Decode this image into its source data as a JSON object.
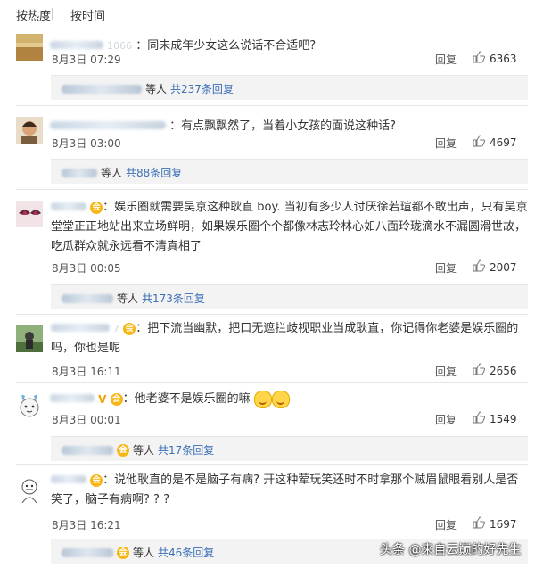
{
  "tabs": {
    "hot": "按热度",
    "time": "按时间"
  },
  "reply_label": "回复",
  "comments": [
    {
      "name": "1066",
      "text": "同未成年少女这么说话不合适吧?",
      "date": "8月3日 07:29",
      "likes": "6363",
      "sub_prefix": "等人",
      "sub_link": "共237条回复"
    },
    {
      "name": "",
      "text": "有点飘飘然了，当着小女孩的面说这种话?",
      "date": "8月3日 03:00",
      "likes": "4697",
      "sub_prefix": "等人",
      "sub_link": "共88条回复"
    },
    {
      "name": "",
      "text": "娱乐圈就需要吴京这种耿直 boy. 当初有多少人讨厌徐若瑄都不敢出声，只有吴京堂堂正正地站出来立场鲜明，如果娱乐圈个个都像林志玲林心如八面玲珑滴水不漏圆滑世故，吃瓜群众就永远看不清真相了",
      "date": "8月3日 00:05",
      "likes": "2007",
      "sub_prefix": "等人",
      "sub_link": "共173条回复"
    },
    {
      "name": "7",
      "text": "把下流当幽默，把口无遮拦歧视职业当成耿直，你记得你老婆是娱乐圈的吗，你也是呢",
      "date": "8月3日 16:11",
      "likes": "2656"
    },
    {
      "name": "",
      "text": "他老婆不是娱乐圈的嘛",
      "date": "8月3日 00:01",
      "likes": "1549",
      "sub_prefix": "等人",
      "sub_link": "共17条回复"
    },
    {
      "name": "",
      "text": "说他耿直的是不是脑子有病? 开这种荤玩笑还时不时拿那个贼眉鼠眼看别人是否笑了，脑子有病啊? ? ?",
      "date": "8月3日 16:21",
      "likes": "1697",
      "sub_prefix": "等人",
      "sub_link": "共46条回复"
    }
  ],
  "watermark": "头条 @来自云巅的好先生",
  "icons": {
    "thumb": "thumbs-up-icon",
    "vip": "vip-icon",
    "badge": "member-badge-icon",
    "emoji": "laughing-emoji-icon"
  },
  "colors": {
    "link": "#3b6fb6",
    "background": "#ffffff",
    "sub_background": "#f3f3f3"
  }
}
